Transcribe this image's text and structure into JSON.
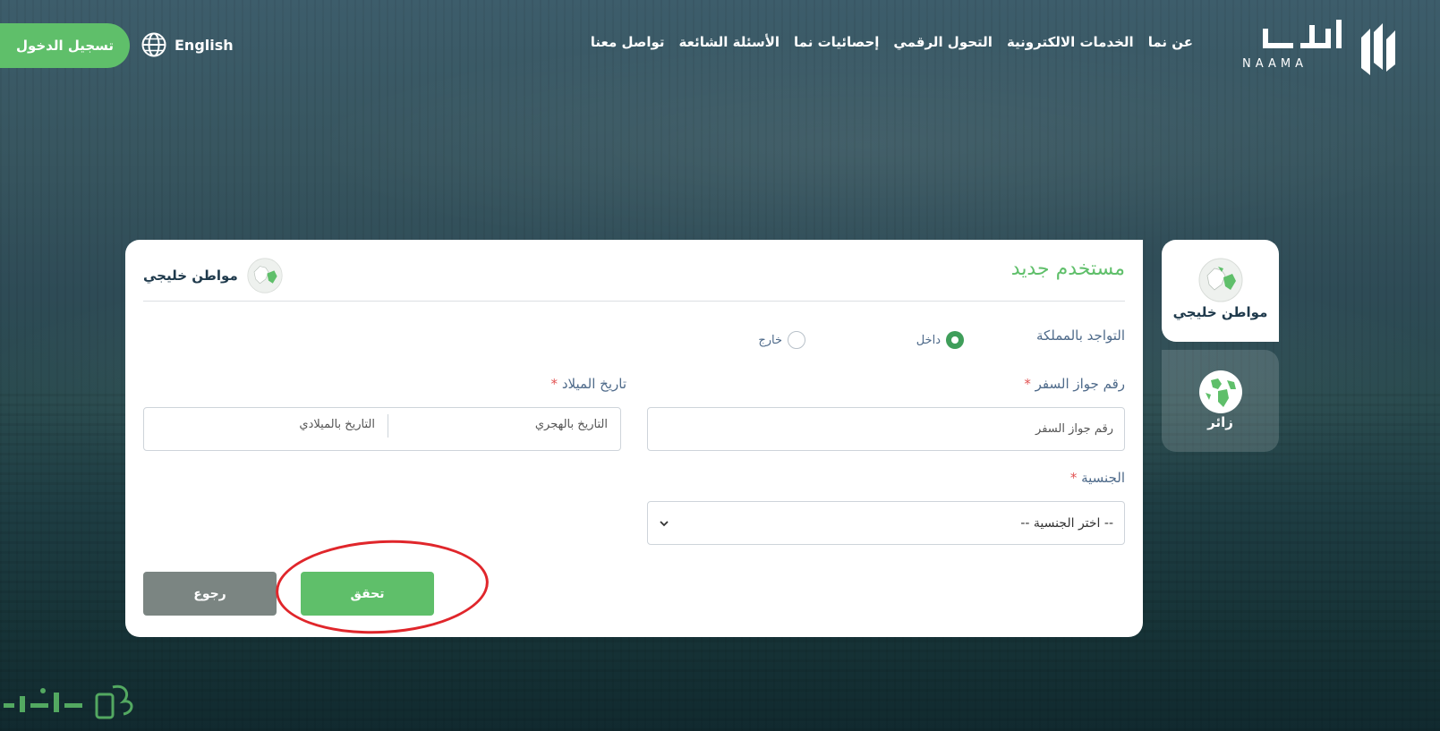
{
  "header": {
    "login_label": "تسجيل الدخول",
    "lang_label": "English",
    "logo_text": "NAAMA",
    "nav": [
      {
        "label": "عن نما"
      },
      {
        "label": "الخدمات الالكترونية"
      },
      {
        "label": "التحول الرقمي"
      },
      {
        "label": "إحصائيات نما"
      },
      {
        "label": "الأسئلة الشائعة"
      },
      {
        "label": "تواصل معنا"
      }
    ]
  },
  "side_tabs": [
    {
      "label": "مواطن خليجي",
      "active": true
    },
    {
      "label": "زائر",
      "active": false
    }
  ],
  "form": {
    "title": "مستخدم جديد",
    "user_type_badge": "مواطن خليجي",
    "residence_label": "التواجد بالمملكة",
    "residence_options": [
      {
        "label": "داخل",
        "selected": true
      },
      {
        "label": "خارج",
        "selected": false
      }
    ],
    "passport_label": "رقم جواز السفر",
    "passport_placeholder": "رقم جواز السفر",
    "dob_label": "تاريخ الميلاد",
    "dob_hijri": "التاريخ بالهجري",
    "dob_gregorian": "التاريخ بالميلادي",
    "nationality_label": "الجنسية",
    "nationality_value": "-- اختر الجنسية --",
    "required_mark": "*",
    "verify_label": "تحقق",
    "back_label": "رجوع"
  },
  "colors": {
    "accent": "#5fbf6a",
    "radio_on": "#3f9e5a",
    "label": "#4e6a8a",
    "required": "#e25353",
    "back": "#7b8582",
    "annotation": "#e0262b"
  },
  "icons": [
    "globe-icon",
    "naama-logo-icon",
    "gulf-map-icon",
    "world-globe-icon",
    "chevron-down-icon",
    "watermark-logo-icon"
  ]
}
